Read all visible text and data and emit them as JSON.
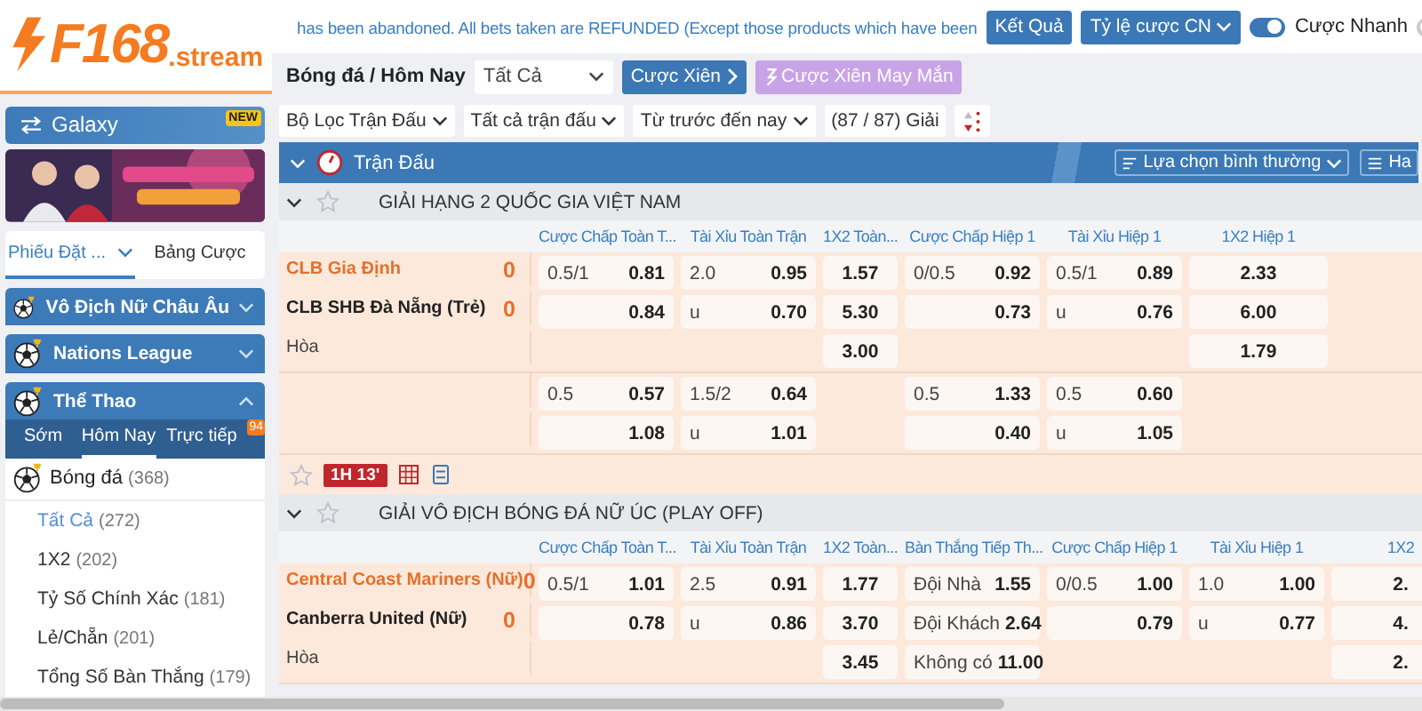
{
  "logo": {
    "brand": "F168",
    "suffix": ".stream"
  },
  "sidebar": {
    "galaxy": {
      "label": "Galaxy",
      "badge": "NEW"
    },
    "tabs": [
      {
        "label": "Phiếu Đặt ...",
        "selected": true,
        "dropdown": true
      },
      {
        "label": "Bảng Cược",
        "selected": false,
        "dropdown": false
      }
    ],
    "sections": [
      {
        "label": "Vô Địch Nữ Châu Âu",
        "expanded": false
      },
      {
        "label": "Nations League",
        "expanded": false
      },
      {
        "label": "Thể Thao",
        "expanded": true
      }
    ],
    "sport_tabs": [
      {
        "label": "Sớm",
        "selected": false
      },
      {
        "label": "Hôm Nay",
        "selected": true
      },
      {
        "label": "Trực tiếp",
        "selected": false,
        "badge": "94"
      }
    ],
    "sport": {
      "label": "Bóng đá",
      "count": "(368)"
    },
    "markets": [
      {
        "label": "Tất Cả",
        "count": "(272)",
        "selected": true
      },
      {
        "label": "1X2",
        "count": "(202)",
        "selected": false
      },
      {
        "label": "Tỷ Số Chính Xác",
        "count": "(181)",
        "selected": false
      },
      {
        "label": "Lẻ/Chẵn",
        "count": "(201)",
        "selected": false
      },
      {
        "label": "Tổng Số Bàn Thắng",
        "count": "(179)",
        "selected": false
      }
    ]
  },
  "topbar": {
    "notice": "has been abandoned. All bets taken are REFUNDED (Except those products which have been",
    "buttons": [
      {
        "label": "Kết Quả",
        "dropdown": false
      },
      {
        "label": "Tỷ lệ cược CN",
        "dropdown": true
      }
    ],
    "toggles": [
      {
        "label": "Cược Nhanh",
        "on": true
      },
      {
        "on": false
      }
    ]
  },
  "toolbar": {
    "breadcrumb": "Bóng đá / Hôm Nay",
    "select": "Tất Cả",
    "buttons": [
      {
        "label": "Cược Xiên",
        "kind": "primary"
      },
      {
        "label": "Cược Xiên May Mắn",
        "kind": "lucky"
      }
    ]
  },
  "filters": [
    {
      "label": "Bộ Lọc Trận Đấu",
      "dropdown": true
    },
    {
      "label": "Tất cả trận đấu",
      "dropdown": true
    },
    {
      "label": "Từ trước đến nay",
      "dropdown": true
    },
    {
      "label": "(87 / 87) Giải",
      "dropdown": false
    }
  ],
  "section_bar": {
    "title": "Trận Đấu",
    "options": [
      "Lựa chọn bình thường",
      "Ha"
    ]
  },
  "leagues": [
    {
      "name": "GIẢI HẠNG 2 QUỐC GIA VIỆT NAM",
      "columns": [
        {
          "label": "Cược Chấp Toàn T...",
          "kind": "handicap"
        },
        {
          "label": "Tài Xỉu Toàn Trận",
          "kind": "handicap"
        },
        {
          "label": "1X2 Toàn...",
          "kind": "result"
        },
        {
          "label": "Cược Chấp Hiệp 1",
          "kind": "handicap"
        },
        {
          "label": "Tài Xỉu Hiệp 1",
          "kind": "handicap"
        },
        {
          "label": "1X2 Hiệp 1",
          "kind": "result"
        }
      ],
      "blocks": [
        [
          {
            "team": "CLB Gia Định",
            "kind": "home",
            "score": "0",
            "cells": [
              {
                "line": "0.5/1",
                "odds": "0.81"
              },
              {
                "line": "2.0",
                "odds": "0.95"
              },
              {
                "odds": "1.57"
              },
              {
                "line": "0/0.5",
                "odds": "0.92"
              },
              {
                "line": "0.5/1",
                "odds": "0.89"
              },
              {
                "odds": "2.33"
              }
            ]
          },
          {
            "team": "CLB SHB Đà Nẵng (Trẻ)",
            "kind": "away",
            "score": "0",
            "cells": [
              {
                "odds": "0.84"
              },
              {
                "line": "u",
                "odds": "0.70"
              },
              {
                "odds": "5.30"
              },
              {
                "odds": "0.73"
              },
              {
                "line": "u",
                "odds": "0.76"
              },
              {
                "odds": "6.00"
              }
            ]
          },
          {
            "team": "Hòa",
            "kind": "draw",
            "cells": [
              null,
              null,
              {
                "odds": "3.00"
              },
              null,
              null,
              {
                "odds": "1.79"
              }
            ]
          }
        ],
        [
          {
            "cells": [
              {
                "line": "0.5",
                "odds": "0.57"
              },
              {
                "line": "1.5/2",
                "odds": "0.64"
              },
              null,
              {
                "line": "0.5",
                "odds": "1.33"
              },
              {
                "line": "0.5",
                "odds": "0.60"
              },
              null
            ]
          },
          {
            "cells": [
              {
                "odds": "1.08"
              },
              {
                "line": "u",
                "odds": "1.01"
              },
              null,
              {
                "odds": "0.40"
              },
              {
                "line": "u",
                "odds": "1.05"
              },
              null
            ]
          }
        ]
      ],
      "live": "1H 13'"
    },
    {
      "name": "GIẢI VÔ ĐỊCH BÓNG ĐÁ NỮ ÚC (PLAY OFF)",
      "columns": [
        {
          "label": "Cược Chấp Toàn T...",
          "kind": "handicap"
        },
        {
          "label": "Tài Xỉu Toàn Trận",
          "kind": "handicap"
        },
        {
          "label": "1X2 Toàn...",
          "kind": "result"
        },
        {
          "label": "Bàn Thắng Tiếp Th...",
          "kind": "handicap"
        },
        {
          "label": "Cược Chấp Hiệp 1",
          "kind": "handicap"
        },
        {
          "label": "Tài Xỉu Hiệp 1",
          "kind": "handicap"
        },
        {
          "label": "1X2",
          "kind": "result"
        }
      ],
      "blocks": [
        [
          {
            "team": "Central Coast Mariners (Nữ)",
            "kind": "home",
            "score": "0",
            "cells": [
              {
                "line": "0.5/1",
                "odds": "1.01"
              },
              {
                "line": "2.5",
                "odds": "0.91"
              },
              {
                "odds": "1.77"
              },
              {
                "line": "Đội Nhà",
                "odds": "1.55"
              },
              {
                "line": "0/0.5",
                "odds": "1.00"
              },
              {
                "line": "1.0",
                "odds": "1.00"
              },
              {
                "odds": "2."
              }
            ]
          },
          {
            "team": "Canberra United (Nữ)",
            "kind": "away",
            "score": "0",
            "cells": [
              {
                "odds": "0.78"
              },
              {
                "line": "u",
                "odds": "0.86"
              },
              {
                "odds": "3.70"
              },
              {
                "line": "Đội Khách",
                "odds": "2.64"
              },
              {
                "odds": "0.79"
              },
              {
                "line": "u",
                "odds": "0.77"
              },
              {
                "odds": "4."
              }
            ]
          },
          {
            "team": "Hòa",
            "kind": "draw",
            "cells": [
              null,
              null,
              {
                "odds": "3.45"
              },
              {
                "line": "Không có",
                "odds": "11.00"
              },
              null,
              null,
              {
                "odds": "2."
              }
            ]
          }
        ]
      ]
    }
  ]
}
